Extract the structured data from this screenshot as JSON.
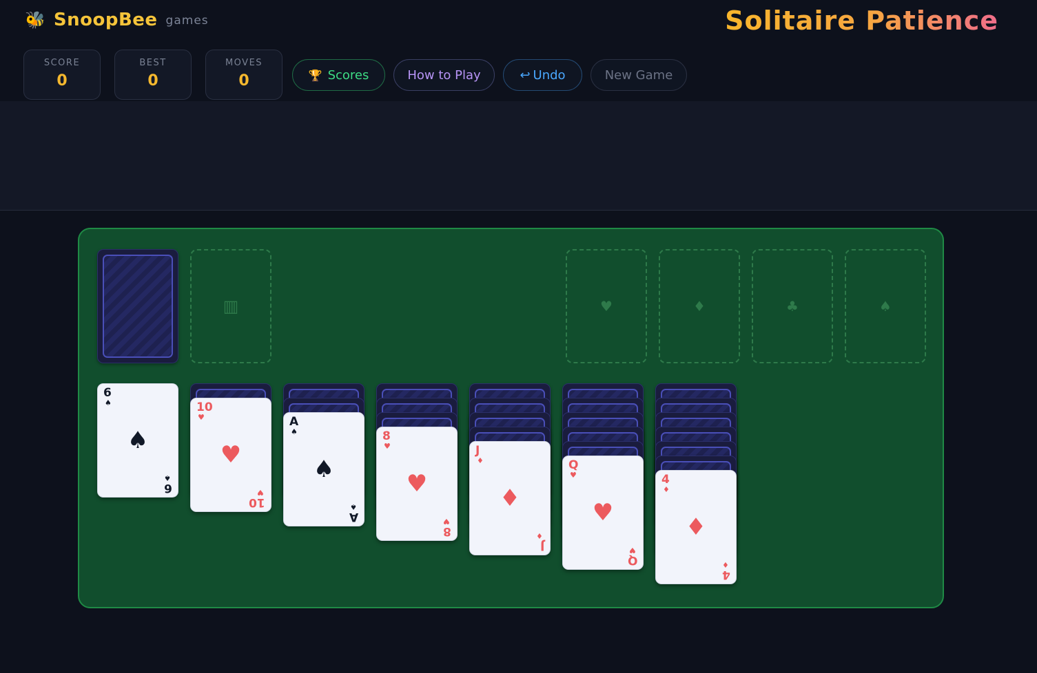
{
  "header": {
    "bee_icon": "🐝",
    "brand": "SnoopBee",
    "brand_sub": "games",
    "title": "Solitaire Patience"
  },
  "stats": [
    {
      "label": "SCORE",
      "value": "0"
    },
    {
      "label": "BEST",
      "value": "0"
    },
    {
      "label": "MOVES",
      "value": "0"
    }
  ],
  "buttons": {
    "scores": {
      "icon": "🏆",
      "label": "Scores",
      "color": "#3ddc84"
    },
    "how_to_play": {
      "label": "How to Play",
      "color": "#b794f6"
    },
    "undo": {
      "icon": "↩",
      "label": "Undo",
      "color": "#4aa8ff"
    },
    "new_game": {
      "label": "New Game",
      "color": "#6b7285"
    }
  },
  "waste_icon": "▥",
  "foundations": [
    "♥",
    "♦",
    "♣",
    "♠"
  ],
  "tableau": [
    {
      "hidden": 0,
      "top": {
        "rank": "6",
        "suit": "♠",
        "color": "black"
      }
    },
    {
      "hidden": 1,
      "top": {
        "rank": "10",
        "suit": "♥",
        "color": "red"
      }
    },
    {
      "hidden": 2,
      "top": {
        "rank": "A",
        "suit": "♠",
        "color": "black"
      }
    },
    {
      "hidden": 3,
      "top": {
        "rank": "8",
        "suit": "♥",
        "color": "red"
      }
    },
    {
      "hidden": 4,
      "top": {
        "rank": "J",
        "suit": "♦",
        "color": "red"
      }
    },
    {
      "hidden": 5,
      "top": {
        "rank": "Q",
        "suit": "♥",
        "color": "red"
      }
    },
    {
      "hidden": 6,
      "top": {
        "rank": "4",
        "suit": "♦",
        "color": "red"
      }
    }
  ]
}
